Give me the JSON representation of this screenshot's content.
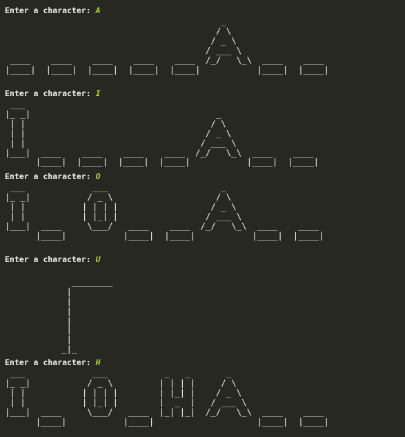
{
  "terminal": {
    "colors": {
      "background": "#272822",
      "foreground": "#f2f2ee",
      "input_accent": "#a6e22e"
    },
    "blocks": [
      {
        "prompt": "Enter a character: ",
        "input": "A",
        "art": "                                          _\n                                         / \\\n                                        / _ \\\n                                       / ___ \\\n ____    ____    ____    ____    ____  /_/   \\_\\  ____    ____\n|____|  |____|  |____|  |____|  |____|           |____|  |____|"
      },
      {
        "prompt": "Enter a character: ",
        "input": "I",
        "art": " ___\n|_ _|                                    _\n | |                                    / \\\n | |                                   / _ \\\n | |                                  / ___ \\\n|___|  ____    ____    ____    ____  /_/   \\_\\  ____    ____\n      |____|  |____|  |____|  |____|           |____|  |____|"
      },
      {
        "prompt": "Enter a character: ",
        "input": "O",
        "art": " ___             ___                      _\n|_ _|           / _ \\                    / \\\n | |           | | | |                  / _ \\\n | |           | |_| |                 / ___ \\\n|___|  ____     \\___/   ____    ____  /_/   \\_\\  ____    ____\n      |____|           |____|  |____|           |____|  |____|"
      },
      {
        "prompt": "Enter a character: ",
        "input": "U",
        "art": "\n             ________\n            |\n            |\n            |\n            |\n            |\n            |\n           _|_"
      },
      {
        "prompt": "Enter a character: ",
        "input": "H",
        "art": " ___             ___           _   _       _\n|_ _|           / _ \\         | | | |     / \\\n | |           | | | |        | |_| |    / _ \\\n | |           | |_| |        |  _  |   / ___ \\\n|___|  ____     \\___/   ____  |_| |_|  /_/   \\_\\  ____    ____\n      |____|           |____|                    |____|  |____|"
      }
    ]
  }
}
